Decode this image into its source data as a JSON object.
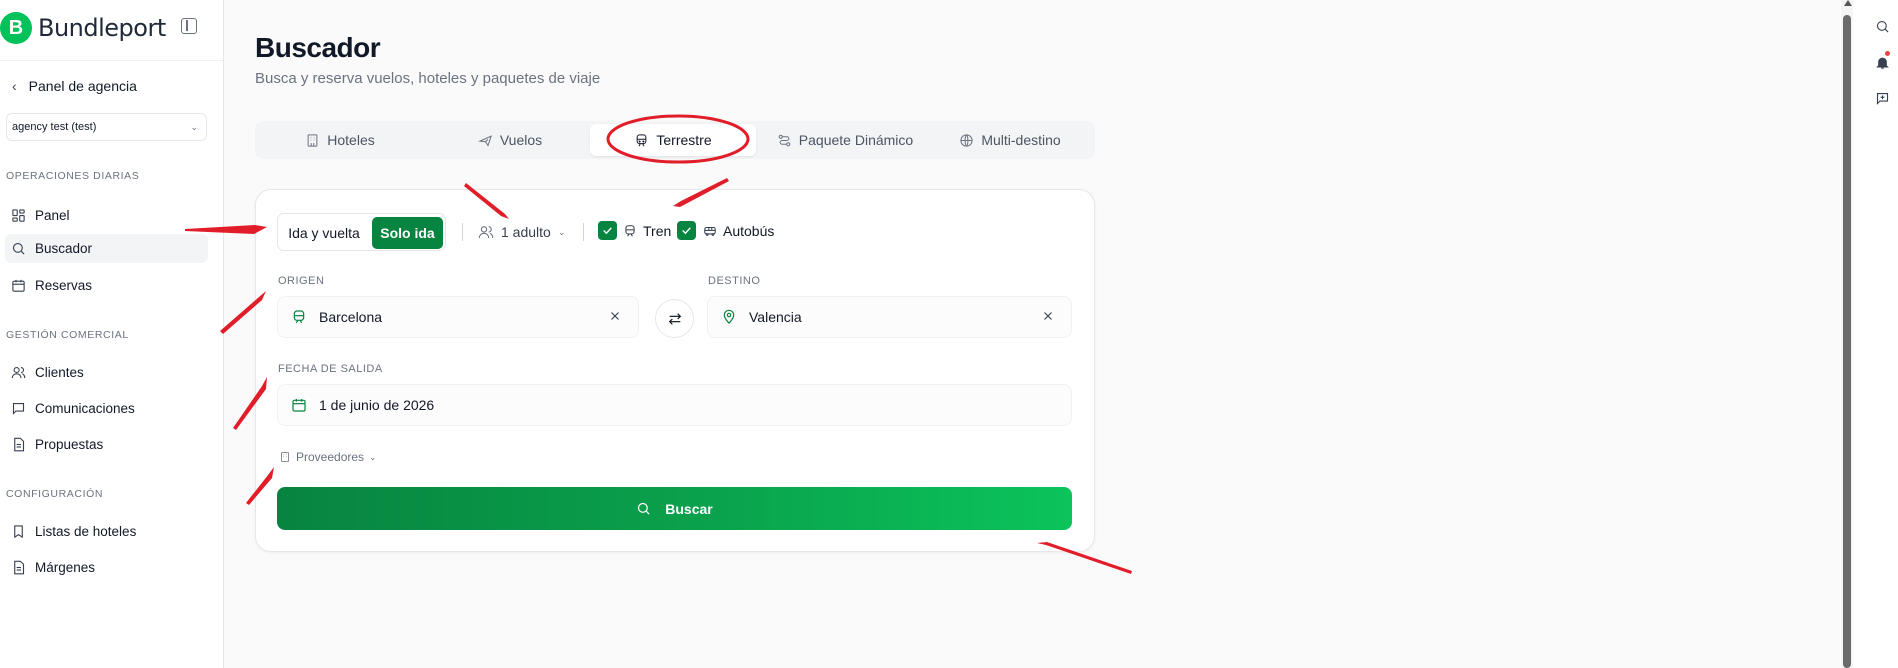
{
  "brand": {
    "name": "Bundleport",
    "logo_letter": "B"
  },
  "sidebar": {
    "back_label": "Panel de agencia",
    "agency_select": "agency test (test)",
    "sections": [
      {
        "title": "OPERACIONES DIARIAS",
        "items": [
          {
            "label": "Panel",
            "icon": "grid-icon"
          },
          {
            "label": "Buscador",
            "icon": "search-icon",
            "active": true
          },
          {
            "label": "Reservas",
            "icon": "calendar-icon"
          }
        ]
      },
      {
        "title": "GESTIÓN COMERCIAL",
        "items": [
          {
            "label": "Clientes",
            "icon": "users-icon"
          },
          {
            "label": "Comunicaciones",
            "icon": "message-icon"
          },
          {
            "label": "Propuestas",
            "icon": "document-icon"
          }
        ]
      },
      {
        "title": "CONFIGURACIÓN",
        "items": [
          {
            "label": "Listas de hoteles",
            "icon": "bookmark-icon"
          },
          {
            "label": "Márgenes",
            "icon": "document-icon"
          }
        ]
      }
    ]
  },
  "main": {
    "title": "Buscador",
    "subtitle": "Busca y reserva vuelos, hoteles y paquetes de viaje",
    "tabs": [
      {
        "label": "Hoteles",
        "icon": "building-icon"
      },
      {
        "label": "Vuelos",
        "icon": "plane-icon"
      },
      {
        "label": "Terrestre",
        "icon": "train-icon",
        "active": true
      },
      {
        "label": "Paquete Dinámico",
        "icon": "route-icon"
      },
      {
        "label": "Multi-destino",
        "icon": "globe-icon"
      }
    ]
  },
  "form": {
    "trip_types": {
      "round_trip": "Ida y vuelta",
      "one_way": "Solo ida",
      "selected": "Solo ida"
    },
    "passengers": "1 adulto",
    "transport": {
      "train": "Tren",
      "bus": "Autobús",
      "train_checked": true,
      "bus_checked": true
    },
    "origin": {
      "label": "ORIGEN",
      "value": "Barcelona"
    },
    "destination": {
      "label": "DESTINO",
      "value": "Valencia"
    },
    "departure": {
      "label": "FECHA DE SALIDA",
      "value": "1 de junio de 2026"
    },
    "providers_label": "Proveedores",
    "search_label": "Buscar"
  },
  "colors": {
    "accent": "#07843f",
    "accent_light": "#0bc45a",
    "annotation": "#e11d2a"
  }
}
